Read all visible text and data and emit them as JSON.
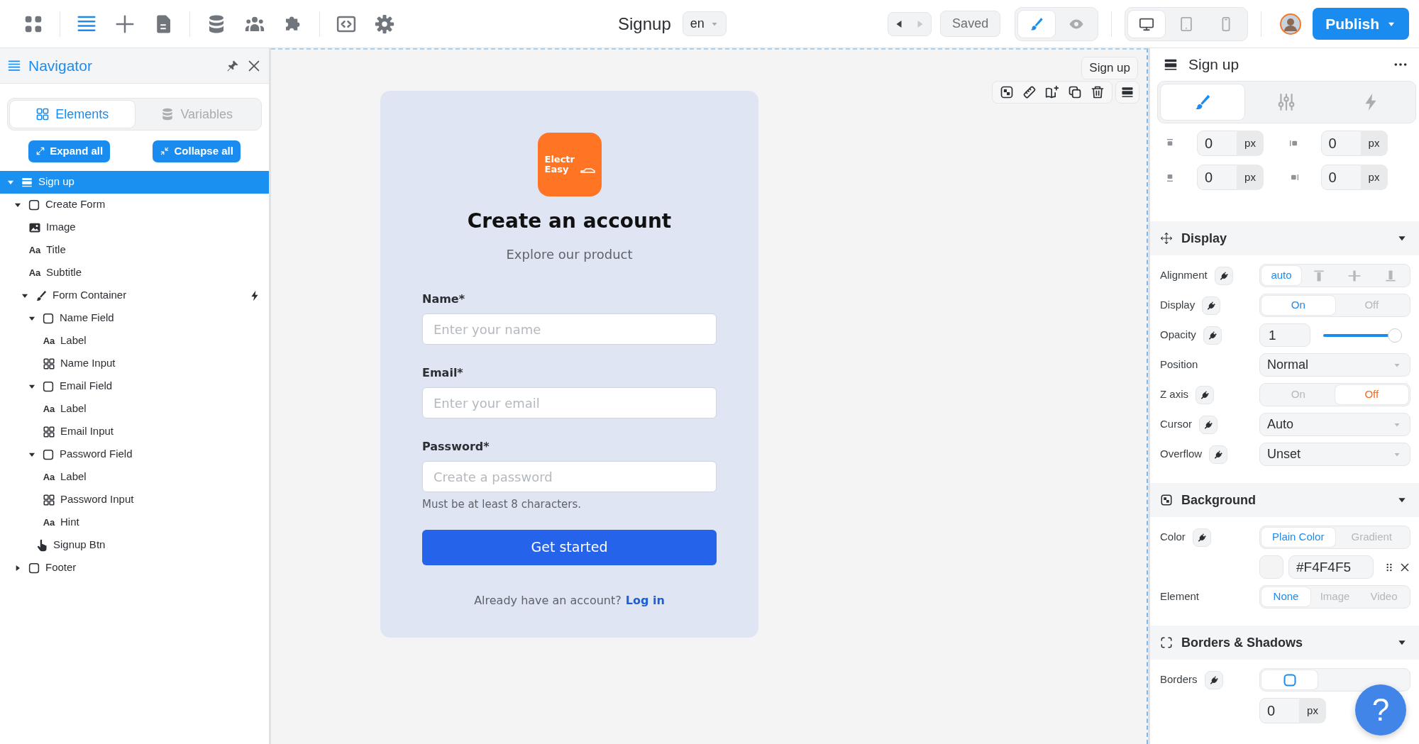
{
  "topbar": {
    "tools": [
      {
        "kind": "apps",
        "selected": false
      },
      {
        "kind": "navigator",
        "selected": true
      },
      {
        "kind": "add",
        "selected": false
      },
      {
        "kind": "pages",
        "selected": false
      },
      {
        "kind": "database",
        "selected": false
      },
      {
        "kind": "users",
        "selected": false
      },
      {
        "kind": "plugins",
        "selected": false
      },
      {
        "kind": "code",
        "selected": false
      },
      {
        "kind": "settings",
        "selected": false
      }
    ],
    "title": "Signup",
    "language": "en",
    "history": [
      {
        "kind": "back",
        "disabled": false
      },
      {
        "kind": "forward",
        "disabled": true
      }
    ],
    "saved": "Saved",
    "modes": [
      {
        "kind": "design",
        "selected": true
      },
      {
        "kind": "preview",
        "selected": false
      }
    ],
    "devices": [
      {
        "kind": "desktop",
        "selected": true
      },
      {
        "kind": "tablet",
        "selected": false
      },
      {
        "kind": "phone",
        "selected": false
      }
    ],
    "publish": "Publish"
  },
  "navigator": {
    "title": "Navigator",
    "tabs": [
      {
        "kind": "elements",
        "label": "Elements",
        "selected": true
      },
      {
        "kind": "variables",
        "label": "Variables",
        "selected": false
      }
    ],
    "expand_all": "Expand all",
    "collapse_all": "Collapse all",
    "tree": [
      {
        "kind": "section",
        "label": "Sign up",
        "expanded": true,
        "selected": true,
        "children": [
          {
            "kind": "box",
            "label": "Create Form",
            "expanded": true,
            "selected": false,
            "children": [
              {
                "kind": "image",
                "label": "Image",
                "selected": false
              },
              {
                "kind": "text",
                "glyph": "Aa",
                "label": "Title",
                "selected": false
              },
              {
                "kind": "text",
                "glyph": "Aa",
                "label": "Subtitle",
                "selected": false
              },
              {
                "kind": "brush",
                "label": "Form Container",
                "expanded": true,
                "selected": false,
                "has_event": true,
                "children": [
                  {
                    "kind": "box",
                    "label": "Name Field",
                    "expanded": true,
                    "selected": false,
                    "children": [
                      {
                        "kind": "text",
                        "glyph": "Aa",
                        "label": "Label",
                        "selected": false
                      },
                      {
                        "kind": "grid",
                        "label": "Name Input",
                        "selected": false
                      }
                    ]
                  },
                  {
                    "kind": "box",
                    "label": "Email Field",
                    "expanded": true,
                    "selected": false,
                    "children": [
                      {
                        "kind": "text",
                        "glyph": "Aa",
                        "label": "Label",
                        "selected": false
                      },
                      {
                        "kind": "grid",
                        "label": "Email Input",
                        "selected": false
                      }
                    ]
                  },
                  {
                    "kind": "box",
                    "label": "Password Field",
                    "expanded": true,
                    "selected": false,
                    "children": [
                      {
                        "kind": "text",
                        "glyph": "Aa",
                        "label": "Label",
                        "selected": false
                      },
                      {
                        "kind": "grid",
                        "label": "Password Input",
                        "selected": false
                      },
                      {
                        "kind": "text",
                        "glyph": "Aa",
                        "label": "Hint",
                        "selected": false
                      }
                    ]
                  },
                  {
                    "kind": "pointer",
                    "label": "Signup Btn",
                    "selected": false
                  }
                ]
              }
            ]
          },
          {
            "kind": "box",
            "label": "Footer",
            "expanded": false,
            "selected": false
          }
        ]
      }
    ]
  },
  "canvas": {
    "element_tag": "Sign up",
    "form": {
      "logo_lines": [
        "Electr",
        "Easy"
      ],
      "title": "Create an account",
      "subtitle": "Explore our product",
      "fields": [
        {
          "label": "Name*",
          "placeholder": "Enter your name"
        },
        {
          "label": "Email*",
          "placeholder": "Enter your email"
        },
        {
          "label": "Password*",
          "placeholder": "Create a password",
          "hint": "Must be at least 8 characters."
        }
      ],
      "button": "Get started",
      "footer_text": "Already have an account?",
      "footer_link": "Log in"
    }
  },
  "properties": {
    "title": "Sign up",
    "tabs": [
      {
        "kind": "style",
        "selected": true
      },
      {
        "kind": "settings",
        "selected": false
      },
      {
        "kind": "interactions",
        "selected": false
      }
    ],
    "spacing": [
      {
        "kind": "top",
        "value": "0",
        "unit": "px"
      },
      {
        "kind": "left",
        "value": "0",
        "unit": "px"
      },
      {
        "kind": "bottom",
        "value": "0",
        "unit": "px"
      },
      {
        "kind": "right",
        "value": "0",
        "unit": "px"
      }
    ],
    "sections": [
      {
        "title": "Display",
        "kind": "display",
        "expanded": true,
        "rows": [
          {
            "kind": "segmented",
            "label": "Alignment",
            "linked": true,
            "options": [
              {
                "kind": "text",
                "label": "auto",
                "selected": true
              },
              {
                "kind": "align-top",
                "selected": false
              },
              {
                "kind": "align-center",
                "selected": false
              },
              {
                "kind": "align-bottom",
                "selected": false
              }
            ]
          },
          {
            "kind": "segmented",
            "label": "Display",
            "linked": true,
            "options": [
              {
                "kind": "text",
                "label": "On",
                "selected": true
              },
              {
                "kind": "text",
                "label": "Off",
                "selected": false
              }
            ]
          },
          {
            "kind": "slider",
            "label": "Opacity",
            "linked": true,
            "value": "1",
            "level": 1
          },
          {
            "kind": "select",
            "label": "Position",
            "linked": false,
            "value": "Normal"
          },
          {
            "kind": "segmented",
            "label": "Z axis",
            "linked": true,
            "options": [
              {
                "kind": "text",
                "label": "On",
                "selected": false
              },
              {
                "kind": "text",
                "label": "Off",
                "selected": true,
                "color": "#f26b1d"
              }
            ]
          },
          {
            "kind": "select",
            "label": "Cursor",
            "linked": true,
            "value": "Auto"
          },
          {
            "kind": "select",
            "label": "Overflow",
            "linked": true,
            "value": "Unset"
          }
        ]
      },
      {
        "title": "Background",
        "kind": "background",
        "expanded": true,
        "rows": [
          {
            "kind": "segmented",
            "label": "Color",
            "linked": true,
            "options": [
              {
                "kind": "text",
                "label": "Plain Color",
                "selected": true
              },
              {
                "kind": "text",
                "label": "Gradient",
                "selected": false
              }
            ]
          },
          {
            "kind": "color",
            "color": "#f4f4f5",
            "value": "#F4F4F5"
          },
          {
            "kind": "segmented",
            "label": "Element",
            "linked": false,
            "options": [
              {
                "kind": "text",
                "label": "None",
                "selected": true
              },
              {
                "kind": "text",
                "label": "Image",
                "selected": false
              },
              {
                "kind": "text",
                "label": "Video",
                "selected": false
              }
            ]
          }
        ]
      },
      {
        "title": "Borders & Shadows",
        "kind": "borders",
        "expanded": true,
        "rows": [
          {
            "kind": "segmented",
            "label": "Borders",
            "linked": true,
            "options": [
              {
                "kind": "border-all",
                "selected": true
              }
            ]
          },
          {
            "kind": "unit",
            "value": "0",
            "unit": "px"
          }
        ]
      }
    ]
  },
  "help": "?"
}
